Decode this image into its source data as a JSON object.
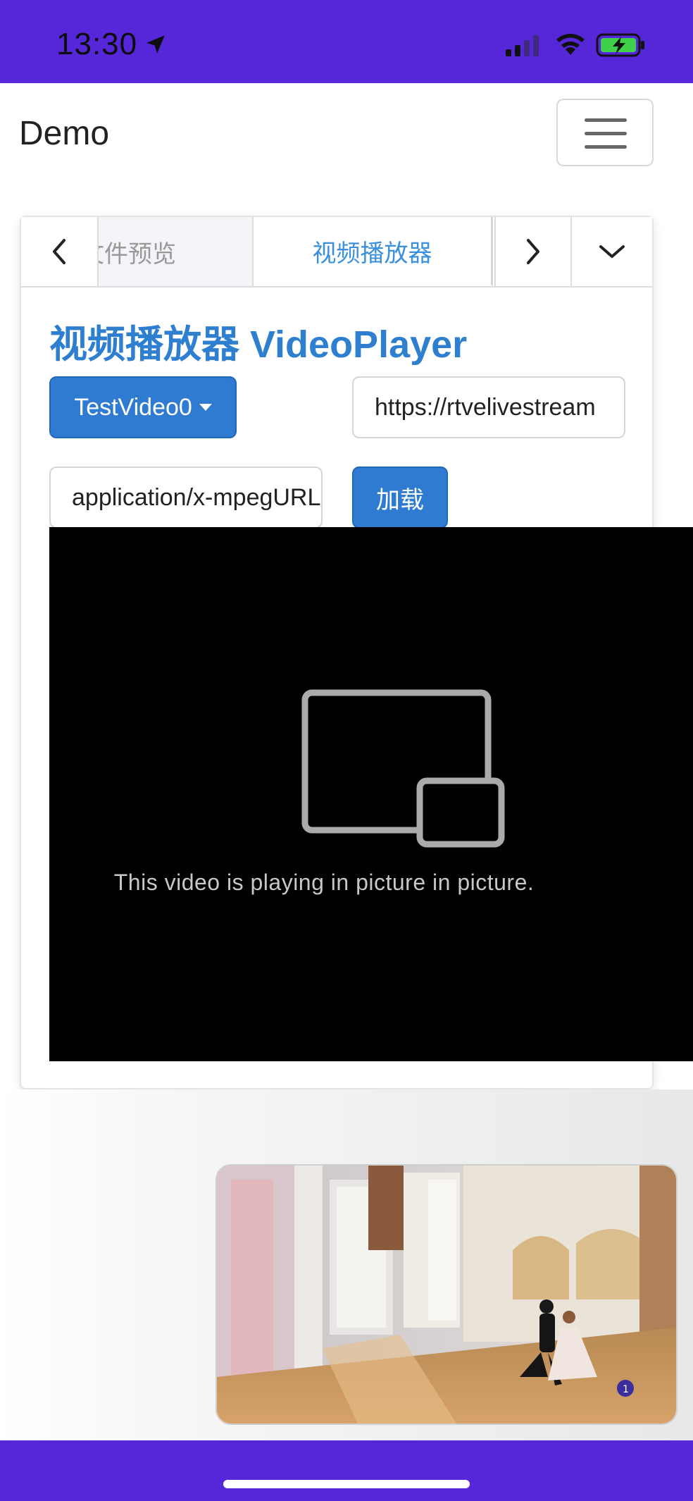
{
  "status_bar": {
    "time": "13:30"
  },
  "navbar": {
    "brand": "Demo"
  },
  "tabs": {
    "prev_label": "文件预览",
    "active_label": "视频播放器"
  },
  "content": {
    "heading": "视频播放器 VideoPlayer",
    "video_select": "TestVideo0",
    "url_value": "https://rtvelivestream",
    "type_value": "application/x-mpegURL",
    "load_label": "加载"
  },
  "video": {
    "pip_message": "This video is playing in picture in picture."
  },
  "colors": {
    "status_bar_bg": "#5627d8",
    "primary": "#2e7bd1",
    "active_tab_text": "#3a90dc",
    "heading": "#2f7fd0"
  },
  "icons": [
    "location-arrow-icon",
    "signal-icon",
    "wifi-icon",
    "battery-charging-icon",
    "chevron-left-icon",
    "chevron-right-icon",
    "chevron-down-icon",
    "picture-in-picture-icon",
    "hamburger-icon"
  ]
}
